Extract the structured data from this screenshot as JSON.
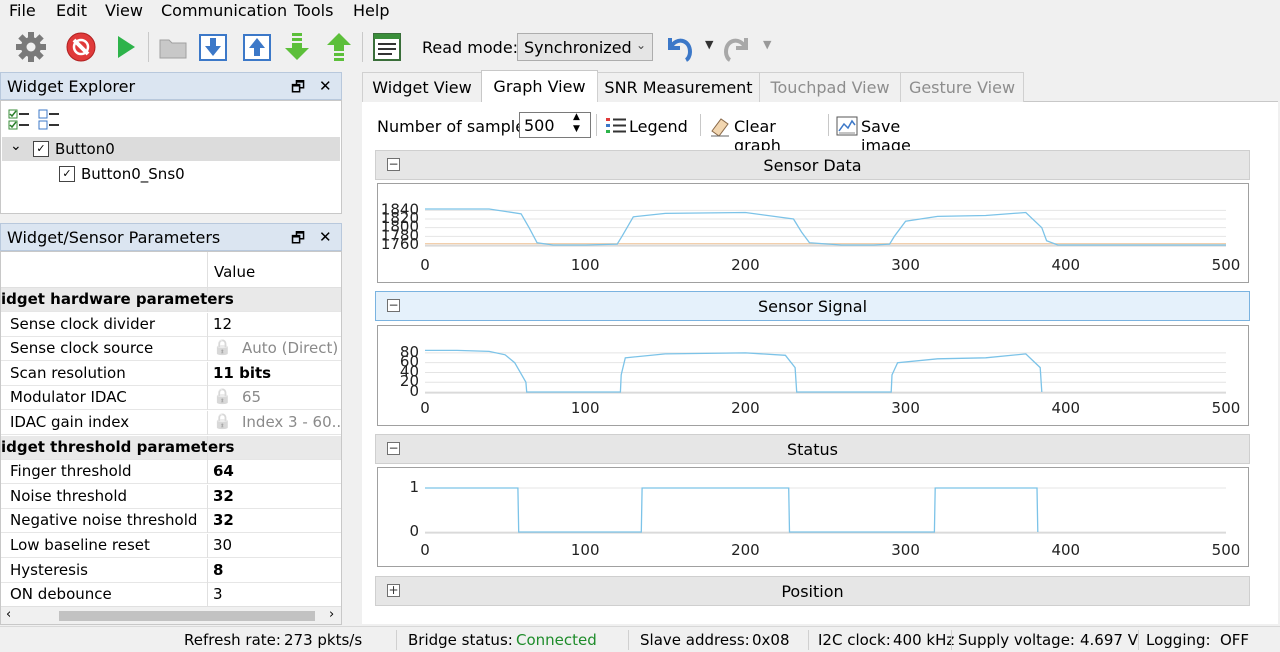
{
  "menu": [
    "File",
    "Edit",
    "View",
    "Communication",
    "Tools",
    "Help"
  ],
  "toolbar": {
    "read_mode_label": "Read mode:",
    "read_mode_value": "Synchronized"
  },
  "widget_explorer": {
    "title": "Widget Explorer",
    "items": [
      {
        "label": "Button0",
        "checked": true
      },
      {
        "label": "Button0_Sns0",
        "checked": true
      }
    ]
  },
  "params": {
    "title": "Widget/Sensor Parameters",
    "value_header": "Value",
    "rows": [
      {
        "name": "idget hardware parameters",
        "group": true
      },
      {
        "name": "Sense clock divider",
        "value": "12"
      },
      {
        "name": "Sense clock source",
        "value": "Auto (Direct)",
        "locked": true
      },
      {
        "name": "Scan resolution",
        "value": "11 bits",
        "bold": true
      },
      {
        "name": "Modulator IDAC",
        "value": "65",
        "locked": true
      },
      {
        "name": "IDAC gain index",
        "value": "Index 3 - 60...",
        "locked": true
      },
      {
        "name": "idget threshold parameters",
        "group": true
      },
      {
        "name": "Finger threshold",
        "value": "64",
        "bold": true
      },
      {
        "name": "Noise threshold",
        "value": "32",
        "bold": true
      },
      {
        "name": "Negative noise threshold",
        "value": "32",
        "bold": true
      },
      {
        "name": "Low baseline reset",
        "value": "30"
      },
      {
        "name": "Hysteresis",
        "value": "8",
        "bold": true
      },
      {
        "name": "ON debounce",
        "value": "3"
      }
    ]
  },
  "tabs": [
    {
      "label": "Widget View",
      "state": "normal"
    },
    {
      "label": "Graph View",
      "state": "active"
    },
    {
      "label": "SNR Measurement",
      "state": "normal"
    },
    {
      "label": "Touchpad View",
      "state": "disabled"
    },
    {
      "label": "Gesture View",
      "state": "disabled"
    }
  ],
  "graph_toolbar": {
    "samples_label": "Number of samples:",
    "samples_value": "500",
    "legend": "Legend",
    "clear": "Clear graph",
    "save": "Save image"
  },
  "graphs": {
    "sensor_data_title": "Sensor Data",
    "sensor_signal_title": "Sensor Signal",
    "status_title": "Status",
    "position_title": "Position"
  },
  "chart_data": [
    {
      "type": "line",
      "title": "Sensor Data",
      "x": [
        0,
        20,
        40,
        60,
        65,
        70,
        80,
        100,
        120,
        123,
        130,
        150,
        200,
        230,
        235,
        240,
        260,
        280,
        290,
        293,
        300,
        320,
        350,
        375,
        385,
        388,
        395,
        500
      ],
      "series": [
        {
          "values": [
            1843,
            1843,
            1843,
            1832,
            1800,
            1765,
            1760,
            1760,
            1762,
            1780,
            1825,
            1833,
            1835,
            1820,
            1790,
            1765,
            1760,
            1760,
            1762,
            1780,
            1815,
            1826,
            1828,
            1835,
            1800,
            1770,
            1760,
            1760
          ]
        }
      ],
      "baseline": 1763,
      "xlim": [
        0,
        500
      ],
      "ylim": [
        1760,
        1850
      ],
      "yticks": [
        1760,
        1780,
        1800,
        1820,
        1840
      ],
      "xticks": [
        0,
        100,
        200,
        300,
        400,
        500
      ]
    },
    {
      "type": "line",
      "title": "Sensor Signal",
      "x": [
        0,
        20,
        40,
        50,
        56,
        63,
        63.5,
        122,
        122.5,
        125,
        150,
        200,
        225,
        231,
        232,
        291,
        291.5,
        295,
        320,
        350,
        375,
        384,
        385
      ],
      "series": [
        {
          "values": [
            85,
            85,
            83,
            76,
            60,
            20,
            0,
            0,
            35,
            70,
            78,
            80,
            75,
            50,
            0,
            0,
            35,
            60,
            68,
            70,
            78,
            50,
            0
          ]
        }
      ],
      "xlim": [
        0,
        500
      ],
      "ylim": [
        0,
        90
      ],
      "yticks": [
        0,
        20,
        40,
        60,
        80
      ],
      "xticks": [
        0,
        100,
        200,
        300,
        400,
        500
      ]
    },
    {
      "type": "line",
      "title": "Status",
      "x": [
        0,
        58,
        58.5,
        135,
        135.5,
        227,
        227.5,
        318,
        318.5,
        382,
        382.5
      ],
      "series": [
        {
          "values": [
            1,
            1,
            0,
            0,
            1,
            1,
            0,
            0,
            1,
            1,
            0
          ]
        }
      ],
      "xlim": [
        0,
        500
      ],
      "ylim": [
        0,
        1
      ],
      "yticks": [
        0,
        1
      ],
      "xticks": [
        0,
        100,
        200,
        300,
        400,
        500
      ]
    }
  ],
  "status_bar": {
    "refresh_label": "Refresh rate:",
    "refresh_value": "273 pkts/s",
    "bridge_label": "Bridge status:",
    "bridge_value": "Connected",
    "slave_label": "Slave address:",
    "slave_value": "0x08",
    "i2c_label": "I2C clock:",
    "i2c_value": "400 kHz",
    "supply_label": "Supply voltage:",
    "supply_value": "4.697 V",
    "logging_label": "Logging:",
    "logging_value": "OFF"
  },
  "colors": {
    "series": "#7cc3e8",
    "baseline": "#f0c8a0",
    "connected": "#1e8c2a",
    "accent": "#3c78c8"
  }
}
